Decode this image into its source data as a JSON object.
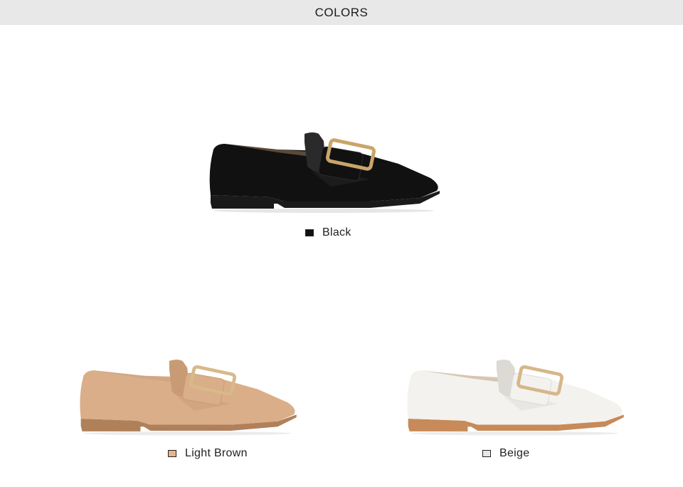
{
  "header": {
    "title": "COLORS"
  },
  "colors": [
    {
      "label": "Black",
      "swatch": "#111111",
      "upper": "#111111",
      "upper_shade": "#2a2a2a",
      "lining": "#9a7a5a",
      "sole": "#1a1a1a",
      "heel": "#2b2b2b",
      "buckle": "#c9a56a"
    },
    {
      "label": "Light Brown",
      "swatch": "#e6b58f",
      "upper": "#d9ae88",
      "upper_shade": "#c99b74",
      "lining": "#c9a184",
      "sole": "#b0805a",
      "heel": "#a67550",
      "buckle": "#d7b98a"
    },
    {
      "label": "Beige",
      "swatch": "#e8e8e8",
      "upper": "#f3f2ee",
      "upper_shade": "#dcdad4",
      "lining": "#c4a183",
      "sole": "#c78a58",
      "heel": "#b87a4b",
      "buckle": "#d6b78a"
    }
  ]
}
